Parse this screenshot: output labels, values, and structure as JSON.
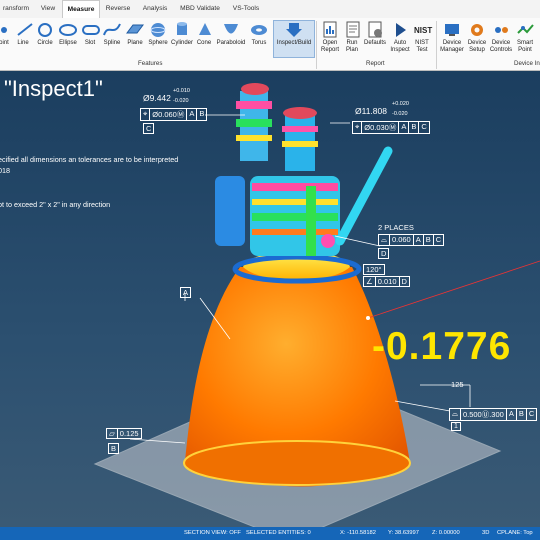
{
  "tabs": [
    "ransform",
    "View",
    "Measure",
    "Reverse",
    "Analysis",
    "MBD Validate",
    "VS-Tools"
  ],
  "ribbon": {
    "features": [
      "oint",
      "Line",
      "Circle",
      "Ellipse",
      "Slot",
      "Spline",
      "Plane",
      "Sphere",
      "Cylinder",
      "Cone",
      "Paraboloid",
      "Torus"
    ],
    "inspect_build": "Inspect/Build",
    "features_group": "Features",
    "report": [
      {
        "line1": "Open",
        "line2": "Report"
      },
      {
        "line1": "Run",
        "line2": "Plan"
      },
      {
        "line1": "Defaults",
        "line2": ""
      },
      {
        "line1": "Auto",
        "line2": "Inspect"
      },
      {
        "line1": "NIST",
        "line2": "Test"
      }
    ],
    "report_group": "Report",
    "device": [
      {
        "line1": "Device",
        "line2": "Manager"
      },
      {
        "line1": "Device",
        "line2": "Setup"
      },
      {
        "line1": "Device",
        "line2": "Controls"
      },
      {
        "line1": "Smart",
        "line2": "Point"
      }
    ],
    "device_group": "Device In"
  },
  "viewport": {
    "title": "\"Inspect1\"",
    "note1": "ecified all dimensions an tolerances are to be interpreted",
    "note2": "018",
    "note3": "ot to exceed 2\" x 2\" in any direction",
    "deviation": "-0.1776",
    "dim_left": {
      "value": "Ø9.442",
      "upper": "+0.010",
      "lower": "-0.020",
      "fcf": [
        "⌖",
        "Ø0.060Ⓜ",
        "A",
        "B"
      ],
      "datum": "C"
    },
    "dim_right": {
      "value": "Ø11.808",
      "upper": "+0.020",
      "lower": "-0.020",
      "fcf": [
        "⌖",
        "Ø0.030Ⓜ",
        "A",
        "B",
        "C"
      ]
    },
    "places": "2 PLACES",
    "profile_fcf": [
      "⌓",
      "0.060",
      "A",
      "B",
      "C"
    ],
    "datum_d": "D",
    "angle": "120°",
    "angle_fcf": [
      "∠",
      "0.010",
      "D"
    ],
    "datum_a": "A",
    "flat_fcf": [
      "▱",
      "0.125"
    ],
    "datum_b": "B",
    "dim_125": "125",
    "prof_fcf": [
      "⌓",
      "0.500Ⓤ.300",
      "A",
      "B",
      "C"
    ],
    "circle_1": "1"
  },
  "colors": {
    "accent": "#1566b8",
    "deviation": "#ffe600",
    "nozzle": "#ff7a00"
  },
  "status": {
    "section_view": "SECTION VIEW: OFF",
    "selected": "SELECTED ENTITIES: 0",
    "x": "X:   -110.58182",
    "y": "Y:   38.63997",
    "z": "Z:   0.00000",
    "mode": "3D",
    "cplane": "CPLANE: Top"
  }
}
